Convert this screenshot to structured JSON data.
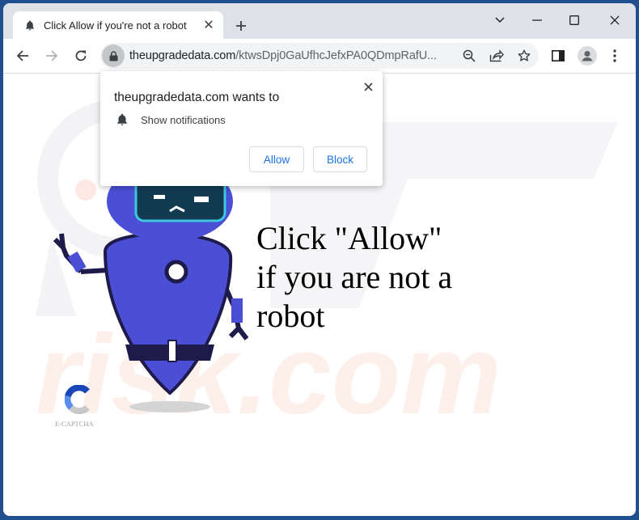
{
  "browser": {
    "tab": {
      "title": "Click Allow if you're not a robot",
      "favicon": "bell-icon",
      "close_icon": "close-icon"
    },
    "new_tab_icon": "plus-icon",
    "window_controls": [
      "chevron-down-icon",
      "minimize-icon",
      "maximize-icon",
      "close-icon"
    ],
    "nav": [
      "back-arrow-icon",
      "forward-arrow-icon",
      "reload-icon"
    ],
    "address_bar": {
      "lock_icon": "lock-icon",
      "host": "theupgradedata.com",
      "path": "/ktwsDpj0GaUfhcJefxPA0QDmpRafU..."
    },
    "omnibox_icons": [
      "zoom-out-icon",
      "share-icon",
      "star-icon"
    ],
    "toolbar_icons": [
      "side-panel-icon",
      "profile-avatar-icon",
      "more-menu-icon"
    ]
  },
  "permission_popup": {
    "title": "theupgradedata.com wants to",
    "permission_icon": "bell-icon",
    "permission_label": "Show notifications",
    "allow_label": "Allow",
    "block_label": "Block",
    "accent_color": "#1a73e8"
  },
  "page": {
    "headline_lines": [
      "Click \"Allow\"",
      "if you are not a",
      "robot"
    ],
    "captcha_label": "E-CAPTCHA",
    "robot_color": "#4a4fd6",
    "watermark_text": "risk.com"
  }
}
